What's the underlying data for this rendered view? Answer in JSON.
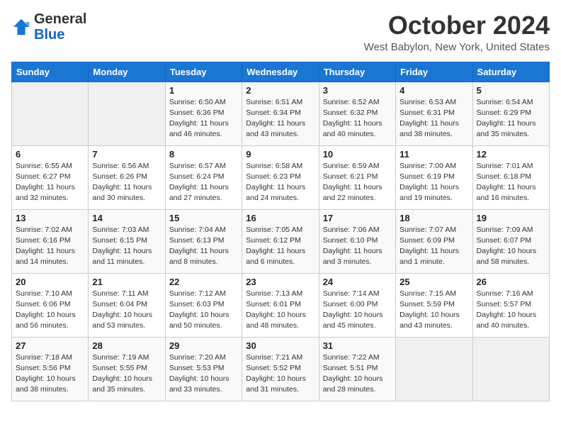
{
  "header": {
    "logo_general": "General",
    "logo_blue": "Blue",
    "month_title": "October 2024",
    "subtitle": "West Babylon, New York, United States"
  },
  "days_of_week": [
    "Sunday",
    "Monday",
    "Tuesday",
    "Wednesday",
    "Thursday",
    "Friday",
    "Saturday"
  ],
  "weeks": [
    [
      {
        "day": "",
        "sunrise": "",
        "sunset": "",
        "daylight": ""
      },
      {
        "day": "",
        "sunrise": "",
        "sunset": "",
        "daylight": ""
      },
      {
        "day": "1",
        "sunrise": "Sunrise: 6:50 AM",
        "sunset": "Sunset: 6:36 PM",
        "daylight": "Daylight: 11 hours and 46 minutes."
      },
      {
        "day": "2",
        "sunrise": "Sunrise: 6:51 AM",
        "sunset": "Sunset: 6:34 PM",
        "daylight": "Daylight: 11 hours and 43 minutes."
      },
      {
        "day": "3",
        "sunrise": "Sunrise: 6:52 AM",
        "sunset": "Sunset: 6:32 PM",
        "daylight": "Daylight: 11 hours and 40 minutes."
      },
      {
        "day": "4",
        "sunrise": "Sunrise: 6:53 AM",
        "sunset": "Sunset: 6:31 PM",
        "daylight": "Daylight: 11 hours and 38 minutes."
      },
      {
        "day": "5",
        "sunrise": "Sunrise: 6:54 AM",
        "sunset": "Sunset: 6:29 PM",
        "daylight": "Daylight: 11 hours and 35 minutes."
      }
    ],
    [
      {
        "day": "6",
        "sunrise": "Sunrise: 6:55 AM",
        "sunset": "Sunset: 6:27 PM",
        "daylight": "Daylight: 11 hours and 32 minutes."
      },
      {
        "day": "7",
        "sunrise": "Sunrise: 6:56 AM",
        "sunset": "Sunset: 6:26 PM",
        "daylight": "Daylight: 11 hours and 30 minutes."
      },
      {
        "day": "8",
        "sunrise": "Sunrise: 6:57 AM",
        "sunset": "Sunset: 6:24 PM",
        "daylight": "Daylight: 11 hours and 27 minutes."
      },
      {
        "day": "9",
        "sunrise": "Sunrise: 6:58 AM",
        "sunset": "Sunset: 6:23 PM",
        "daylight": "Daylight: 11 hours and 24 minutes."
      },
      {
        "day": "10",
        "sunrise": "Sunrise: 6:59 AM",
        "sunset": "Sunset: 6:21 PM",
        "daylight": "Daylight: 11 hours and 22 minutes."
      },
      {
        "day": "11",
        "sunrise": "Sunrise: 7:00 AM",
        "sunset": "Sunset: 6:19 PM",
        "daylight": "Daylight: 11 hours and 19 minutes."
      },
      {
        "day": "12",
        "sunrise": "Sunrise: 7:01 AM",
        "sunset": "Sunset: 6:18 PM",
        "daylight": "Daylight: 11 hours and 16 minutes."
      }
    ],
    [
      {
        "day": "13",
        "sunrise": "Sunrise: 7:02 AM",
        "sunset": "Sunset: 6:16 PM",
        "daylight": "Daylight: 11 hours and 14 minutes."
      },
      {
        "day": "14",
        "sunrise": "Sunrise: 7:03 AM",
        "sunset": "Sunset: 6:15 PM",
        "daylight": "Daylight: 11 hours and 11 minutes."
      },
      {
        "day": "15",
        "sunrise": "Sunrise: 7:04 AM",
        "sunset": "Sunset: 6:13 PM",
        "daylight": "Daylight: 11 hours and 8 minutes."
      },
      {
        "day": "16",
        "sunrise": "Sunrise: 7:05 AM",
        "sunset": "Sunset: 6:12 PM",
        "daylight": "Daylight: 11 hours and 6 minutes."
      },
      {
        "day": "17",
        "sunrise": "Sunrise: 7:06 AM",
        "sunset": "Sunset: 6:10 PM",
        "daylight": "Daylight: 11 hours and 3 minutes."
      },
      {
        "day": "18",
        "sunrise": "Sunrise: 7:07 AM",
        "sunset": "Sunset: 6:09 PM",
        "daylight": "Daylight: 11 hours and 1 minute."
      },
      {
        "day": "19",
        "sunrise": "Sunrise: 7:09 AM",
        "sunset": "Sunset: 6:07 PM",
        "daylight": "Daylight: 10 hours and 58 minutes."
      }
    ],
    [
      {
        "day": "20",
        "sunrise": "Sunrise: 7:10 AM",
        "sunset": "Sunset: 6:06 PM",
        "daylight": "Daylight: 10 hours and 56 minutes."
      },
      {
        "day": "21",
        "sunrise": "Sunrise: 7:11 AM",
        "sunset": "Sunset: 6:04 PM",
        "daylight": "Daylight: 10 hours and 53 minutes."
      },
      {
        "day": "22",
        "sunrise": "Sunrise: 7:12 AM",
        "sunset": "Sunset: 6:03 PM",
        "daylight": "Daylight: 10 hours and 50 minutes."
      },
      {
        "day": "23",
        "sunrise": "Sunrise: 7:13 AM",
        "sunset": "Sunset: 6:01 PM",
        "daylight": "Daylight: 10 hours and 48 minutes."
      },
      {
        "day": "24",
        "sunrise": "Sunrise: 7:14 AM",
        "sunset": "Sunset: 6:00 PM",
        "daylight": "Daylight: 10 hours and 45 minutes."
      },
      {
        "day": "25",
        "sunrise": "Sunrise: 7:15 AM",
        "sunset": "Sunset: 5:59 PM",
        "daylight": "Daylight: 10 hours and 43 minutes."
      },
      {
        "day": "26",
        "sunrise": "Sunrise: 7:16 AM",
        "sunset": "Sunset: 5:57 PM",
        "daylight": "Daylight: 10 hours and 40 minutes."
      }
    ],
    [
      {
        "day": "27",
        "sunrise": "Sunrise: 7:18 AM",
        "sunset": "Sunset: 5:56 PM",
        "daylight": "Daylight: 10 hours and 38 minutes."
      },
      {
        "day": "28",
        "sunrise": "Sunrise: 7:19 AM",
        "sunset": "Sunset: 5:55 PM",
        "daylight": "Daylight: 10 hours and 35 minutes."
      },
      {
        "day": "29",
        "sunrise": "Sunrise: 7:20 AM",
        "sunset": "Sunset: 5:53 PM",
        "daylight": "Daylight: 10 hours and 33 minutes."
      },
      {
        "day": "30",
        "sunrise": "Sunrise: 7:21 AM",
        "sunset": "Sunset: 5:52 PM",
        "daylight": "Daylight: 10 hours and 31 minutes."
      },
      {
        "day": "31",
        "sunrise": "Sunrise: 7:22 AM",
        "sunset": "Sunset: 5:51 PM",
        "daylight": "Daylight: 10 hours and 28 minutes."
      },
      {
        "day": "",
        "sunrise": "",
        "sunset": "",
        "daylight": ""
      },
      {
        "day": "",
        "sunrise": "",
        "sunset": "",
        "daylight": ""
      }
    ]
  ]
}
